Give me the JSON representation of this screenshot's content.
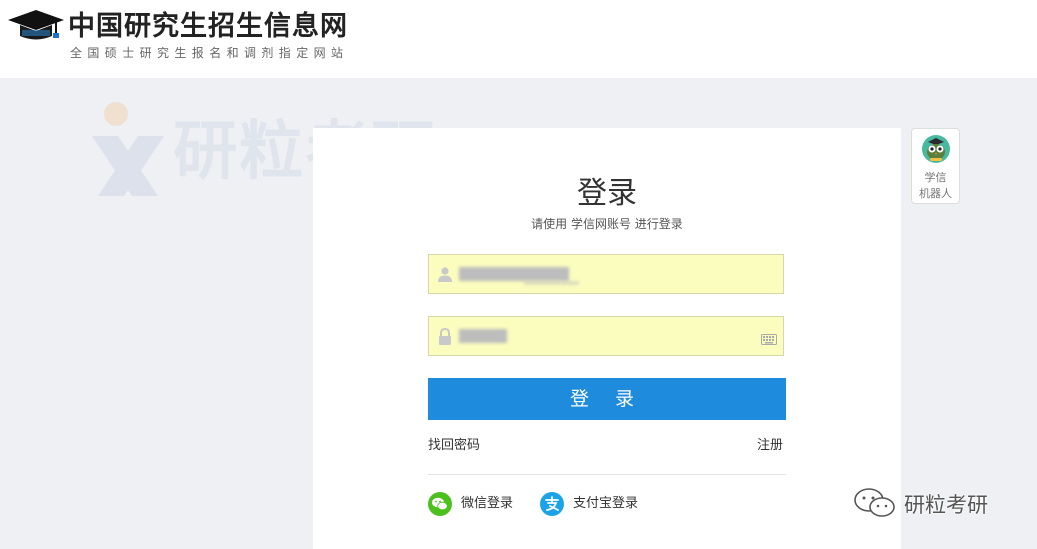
{
  "header": {
    "title": "中国研究生招生信息网",
    "subtitle": "全国硕士研究生报名和调剂指定网站",
    "logo_icon": "graduation-cap-icon"
  },
  "watermark": {
    "text": "研粒考研"
  },
  "login": {
    "title": "登录",
    "subtitle": "请使用 学信网账号 进行登录",
    "username_field": {
      "value": "",
      "icon": "user-icon",
      "masked": true
    },
    "password_field": {
      "value": "",
      "icon": "lock-icon",
      "masked": true,
      "keyboard_icon": "keyboard-icon"
    },
    "login_button": "登 录",
    "forgot_password": "找回密码",
    "register": "注册",
    "social": [
      {
        "label": "微信登录",
        "icon": "wechat-icon",
        "color": "#4cc01c"
      },
      {
        "label": "支付宝登录",
        "icon": "alipay-icon",
        "color": "#1aa3e6"
      }
    ]
  },
  "robot": {
    "line1": "学信",
    "line2": "机器人",
    "icon": "robot-owl-icon"
  },
  "wechat_watermark": {
    "text": "研粒考研",
    "icon": "wechat-icon"
  },
  "colors": {
    "primary": "#1f8bdc",
    "field_bg": "#fbfdbf",
    "page_bg": "#eef0f3"
  }
}
